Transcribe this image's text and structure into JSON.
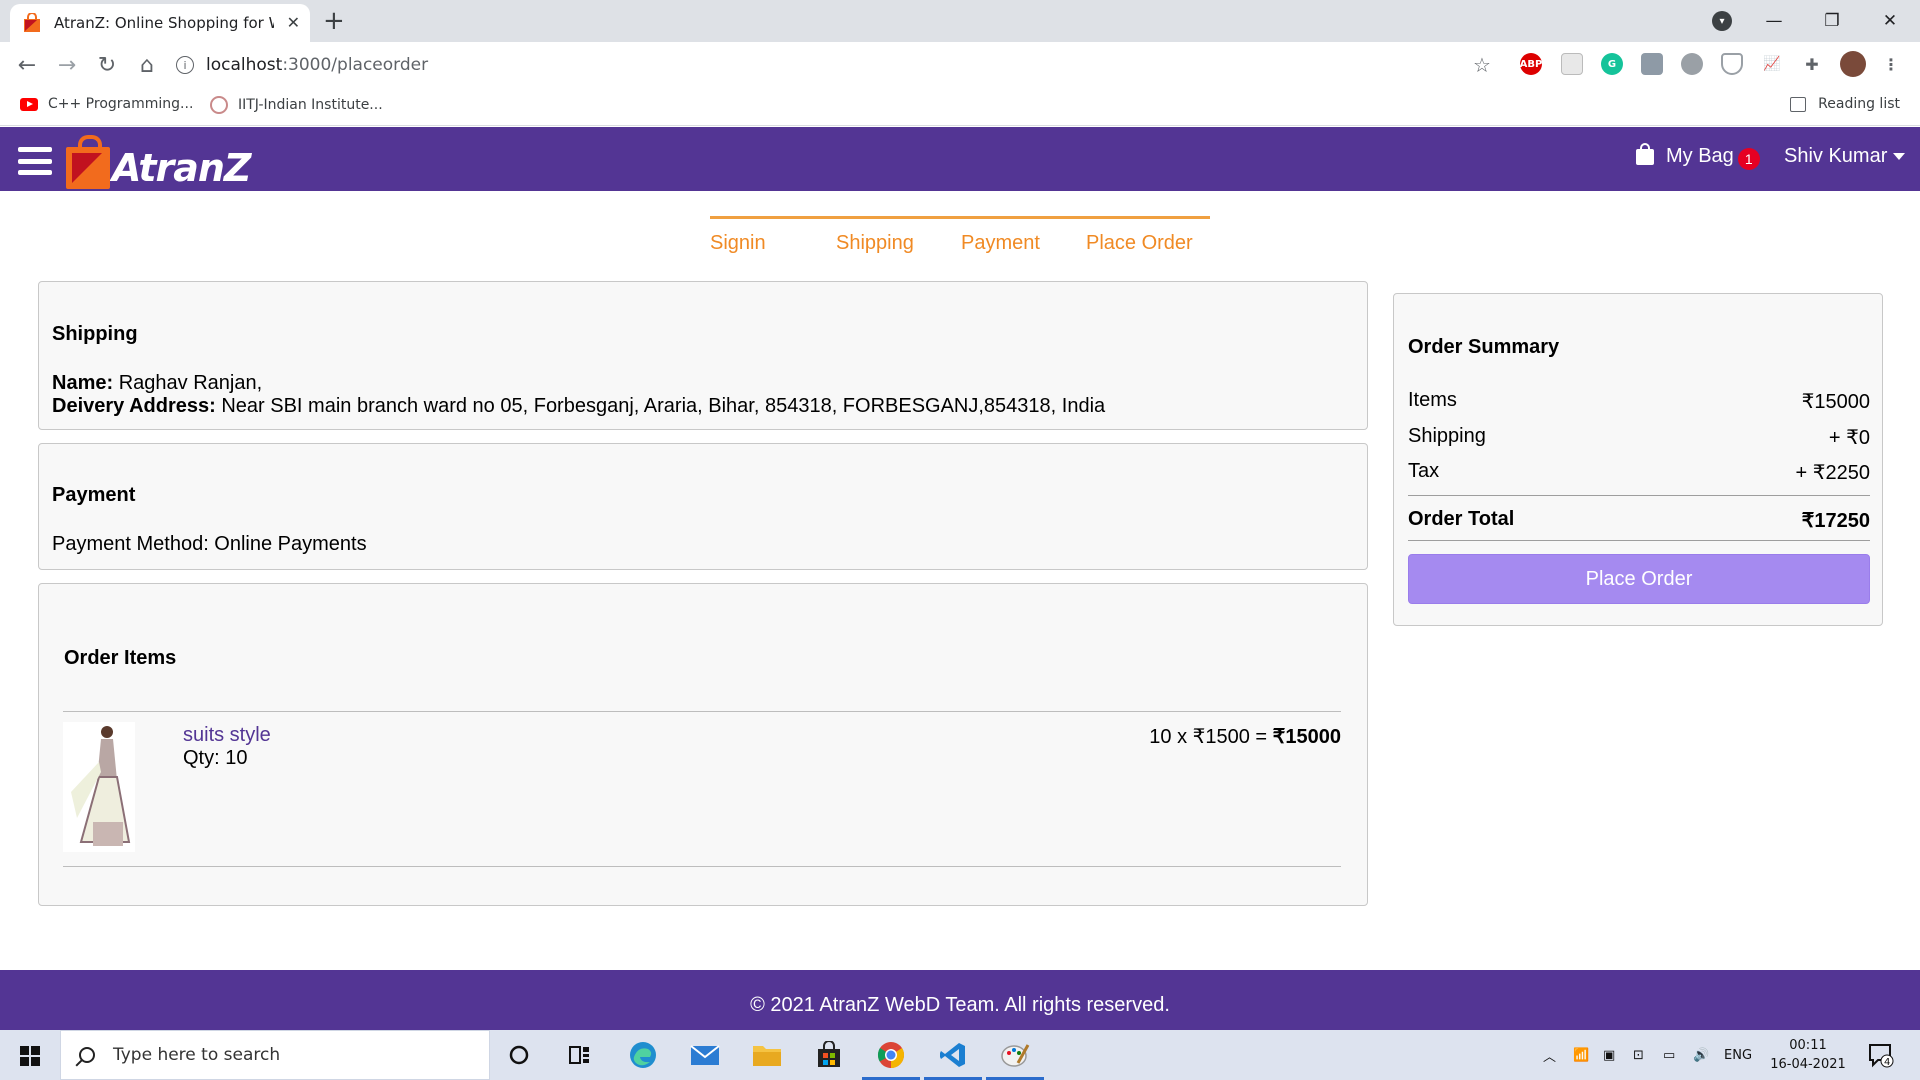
{
  "browser": {
    "tab_title": "AtranZ: Online Shopping for Wor",
    "url_host": "localhost",
    "url_path": ":3000/placeorder",
    "bookmarks": [
      "C++ Programming...",
      "IITJ-Indian Institute..."
    ],
    "reading_list": "Reading list",
    "extension_abp": "ABP",
    "profile_badge": "1"
  },
  "header": {
    "brand": "AtranZ",
    "bag_label": "My Bag",
    "bag_count": "1",
    "user_name": "Shiv Kumar"
  },
  "steps": [
    "Signin",
    "Shipping",
    "Payment",
    "Place Order"
  ],
  "shipping": {
    "heading": "Shipping",
    "name_label": "Name:",
    "name_value": " Raghav Ranjan,",
    "address_label": "Deivery Address:",
    "address_value": " Near SBI main branch ward no 05, Forbesganj, Araria, Bihar, 854318, FORBESGANJ,854318, India"
  },
  "payment": {
    "heading": "Payment",
    "method": "Payment Method: Online Payments"
  },
  "order_items": {
    "heading": "Order Items",
    "items": [
      {
        "name": "suits style",
        "qty": "Qty: 10",
        "calc": "10 x ₹1500 = ",
        "total": "₹15000"
      }
    ]
  },
  "summary": {
    "heading": "Order Summary",
    "items_label": "Items",
    "items_value": "₹15000",
    "shipping_label": "Shipping",
    "shipping_value": "+ ₹0",
    "tax_label": "Tax",
    "tax_value": "+ ₹2250",
    "total_label": "Order Total",
    "total_value": "₹17250",
    "button": "Place Order"
  },
  "footer": {
    "text": "© 2021 AtranZ WebD Team. All rights reserved."
  },
  "taskbar": {
    "search_placeholder": "Type here to search",
    "language": "ENG",
    "time": "00:11",
    "date": "16-04-2021",
    "notification_count": "4"
  },
  "colors": {
    "brand_purple": "#533594",
    "step_orange": "#f08a24",
    "button_lavender": "#a58af0",
    "badge_red": "#e60023"
  }
}
